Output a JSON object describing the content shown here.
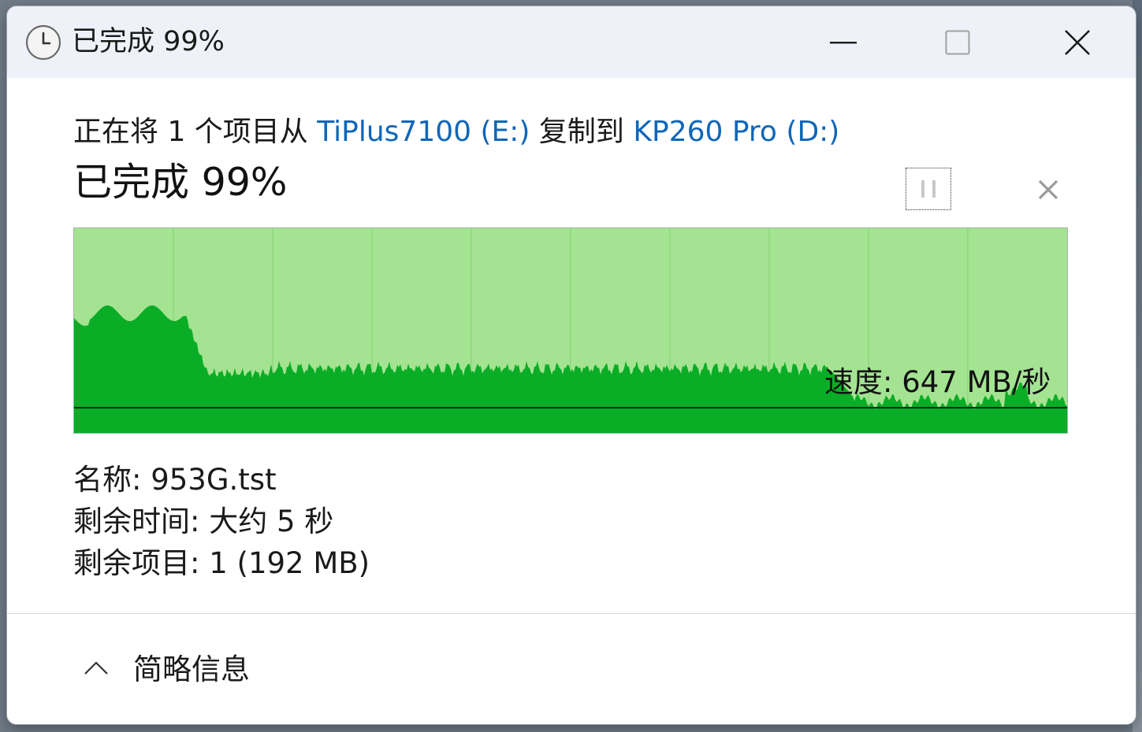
{
  "window": {
    "title": "已完成 99%",
    "icon": "clock-icon",
    "controls": {
      "minimize_icon": "minimize-icon",
      "maximize_icon": "maximize-icon",
      "close_icon": "close-icon"
    }
  },
  "copy": {
    "prefix": "正在将 1 个项目从",
    "source": "TiPlus7100 (E:)",
    "middle": "复制到",
    "destination": "KP260 Pro (D:)"
  },
  "progress": {
    "label": "已完成 99%",
    "percent": 99,
    "pause_icon": "pause-icon",
    "cancel_icon": "cancel-x-icon"
  },
  "graph": {
    "speed_label": "速度: 647 MB/秒",
    "colors": {
      "area": "#0aad26",
      "background": "#a4e392",
      "grid": "#8fd77e",
      "line": "#000000"
    }
  },
  "details": {
    "name": "名称: 953G.tst",
    "time_remaining": "剩余时间: 大约 5 秒",
    "items_remaining": "剩余项目: 1 (192 MB)"
  },
  "footer": {
    "toggle_icon": "chevron-up-icon",
    "toggle_label": "简略信息"
  }
}
